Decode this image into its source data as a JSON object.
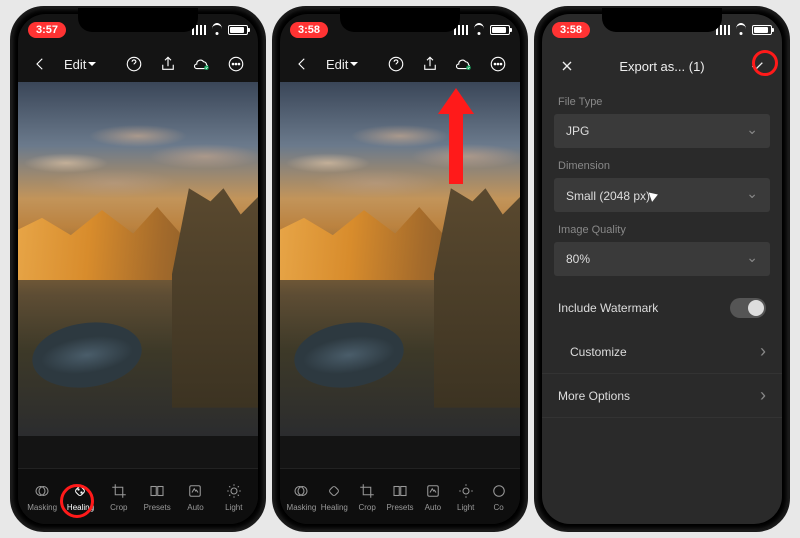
{
  "phones": {
    "left": {
      "time": "3:57",
      "title": "Edit",
      "tools": [
        {
          "name": "masking",
          "label": "Masking"
        },
        {
          "name": "healing",
          "label": "Healing"
        },
        {
          "name": "crop",
          "label": "Crop"
        },
        {
          "name": "presets",
          "label": "Presets"
        },
        {
          "name": "auto",
          "label": "Auto"
        },
        {
          "name": "light",
          "label": "Light"
        }
      ]
    },
    "middle": {
      "time": "3:58",
      "title": "Edit",
      "tools": [
        {
          "name": "masking",
          "label": "Masking"
        },
        {
          "name": "healing",
          "label": "Healing"
        },
        {
          "name": "crop",
          "label": "Crop"
        },
        {
          "name": "presets",
          "label": "Presets"
        },
        {
          "name": "auto",
          "label": "Auto"
        },
        {
          "name": "light",
          "label": "Light"
        },
        {
          "name": "color",
          "label": "Co"
        }
      ]
    },
    "right": {
      "time": "3:58",
      "header": "Export as... (1)",
      "file_type_label": "File Type",
      "file_type_value": "JPG",
      "dimension_label": "Dimension",
      "dimension_value": "Small (2048 px)",
      "quality_label": "Image Quality",
      "quality_value": "80%",
      "watermark_label": "Include Watermark",
      "customize_label": "Customize",
      "more_label": "More Options"
    }
  }
}
